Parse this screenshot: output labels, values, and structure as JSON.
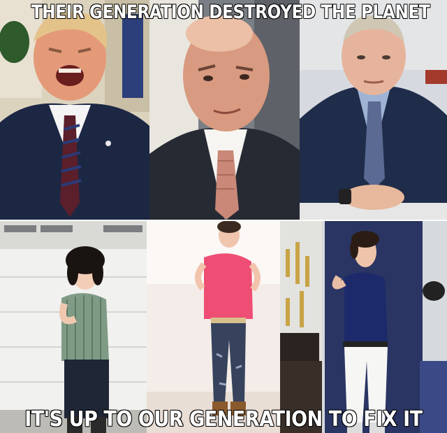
{
  "meme": {
    "top_caption": "THEIR GENERATION DESTROYED THE PLANET",
    "bottom_caption": "IT'S UP TO OUR GENERATION TO FIX IT"
  },
  "panels": [
    {
      "id": "p1",
      "subject": "older man in navy suit and striped tie, shouting"
    },
    {
      "id": "p2",
      "subject": "bald older man in dark suit with pink tie"
    },
    {
      "id": "p3",
      "subject": "older man in navy suit seated at desk, hands folded"
    },
    {
      "id": "p4",
      "subject": "teen with curly hair in striped shirt pointing at self, garage background"
    },
    {
      "id": "p5",
      "subject": "boy in pink polo and ripped jeans posing"
    },
    {
      "id": "p6",
      "subject": "teen in navy polo and white jeans pointing at self, bedroom with trophies"
    }
  ],
  "colors": {
    "caption_fill": "#ffffff",
    "caption_stroke": "#000000"
  }
}
